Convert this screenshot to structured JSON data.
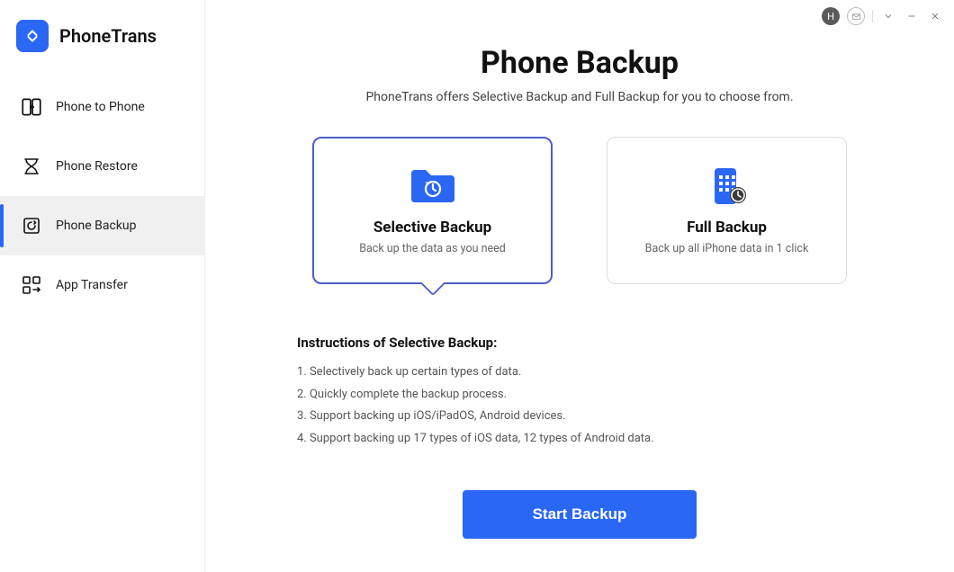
{
  "app": {
    "name": "PhoneTrans"
  },
  "sidebar": {
    "items": [
      {
        "label": "Phone to Phone",
        "active": false
      },
      {
        "label": "Phone Restore",
        "active": false
      },
      {
        "label": "Phone Backup",
        "active": true
      },
      {
        "label": "App Transfer",
        "active": false
      }
    ]
  },
  "titlebar": {
    "avatar_initial": "H"
  },
  "main": {
    "title": "Phone Backup",
    "subtitle": "PhoneTrans offers Selective Backup and Full Backup for you to choose from."
  },
  "cards": {
    "selective": {
      "title": "Selective Backup",
      "desc": "Back up the data as you need"
    },
    "full": {
      "title": "Full Backup",
      "desc": "Back up all iPhone data in 1 click"
    }
  },
  "instructions": {
    "title": "Instructions of Selective Backup:",
    "items": [
      "1. Selectively back up certain types of data.",
      "2. Quickly complete the backup process.",
      "3. Support backing up iOS/iPadOS, Android devices.",
      "4. Support backing up 17 types of iOS data, 12 types of Android data."
    ]
  },
  "cta": {
    "label": "Start Backup"
  }
}
